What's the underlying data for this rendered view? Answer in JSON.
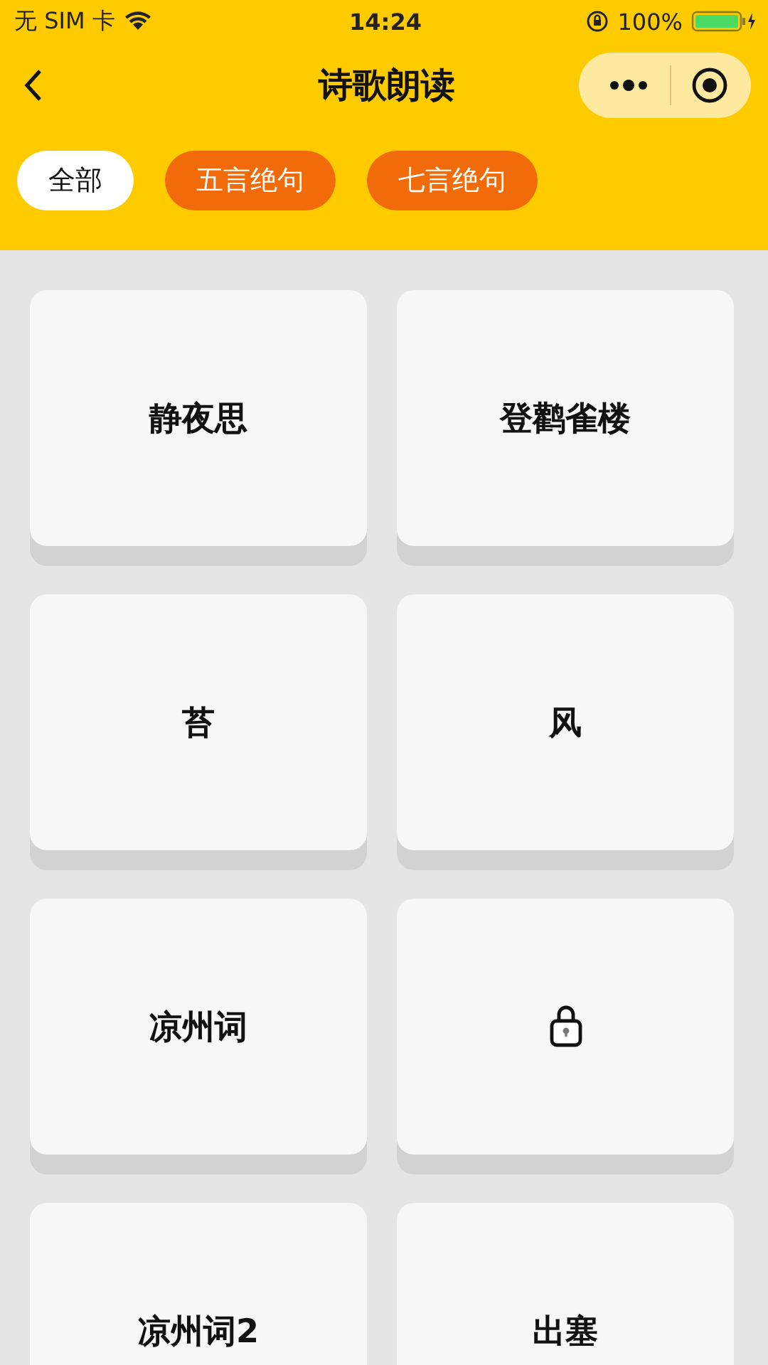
{
  "status_bar": {
    "carrier": "无 SIM 卡",
    "time": "14:24",
    "battery": "100%"
  },
  "nav": {
    "title": "诗歌朗读"
  },
  "tabs": [
    {
      "label": "全部",
      "selected": true
    },
    {
      "label": "五言绝句",
      "selected": false
    },
    {
      "label": "七言绝句",
      "selected": false
    }
  ],
  "poems": [
    {
      "title": "静夜思",
      "locked": false
    },
    {
      "title": "登鹳雀楼",
      "locked": false
    },
    {
      "title": "苔",
      "locked": false
    },
    {
      "title": "风",
      "locked": false
    },
    {
      "title": "凉州词",
      "locked": false
    },
    {
      "locked": true
    },
    {
      "title": "凉州词2",
      "locked": false
    },
    {
      "title": "出塞",
      "locked": false
    }
  ]
}
